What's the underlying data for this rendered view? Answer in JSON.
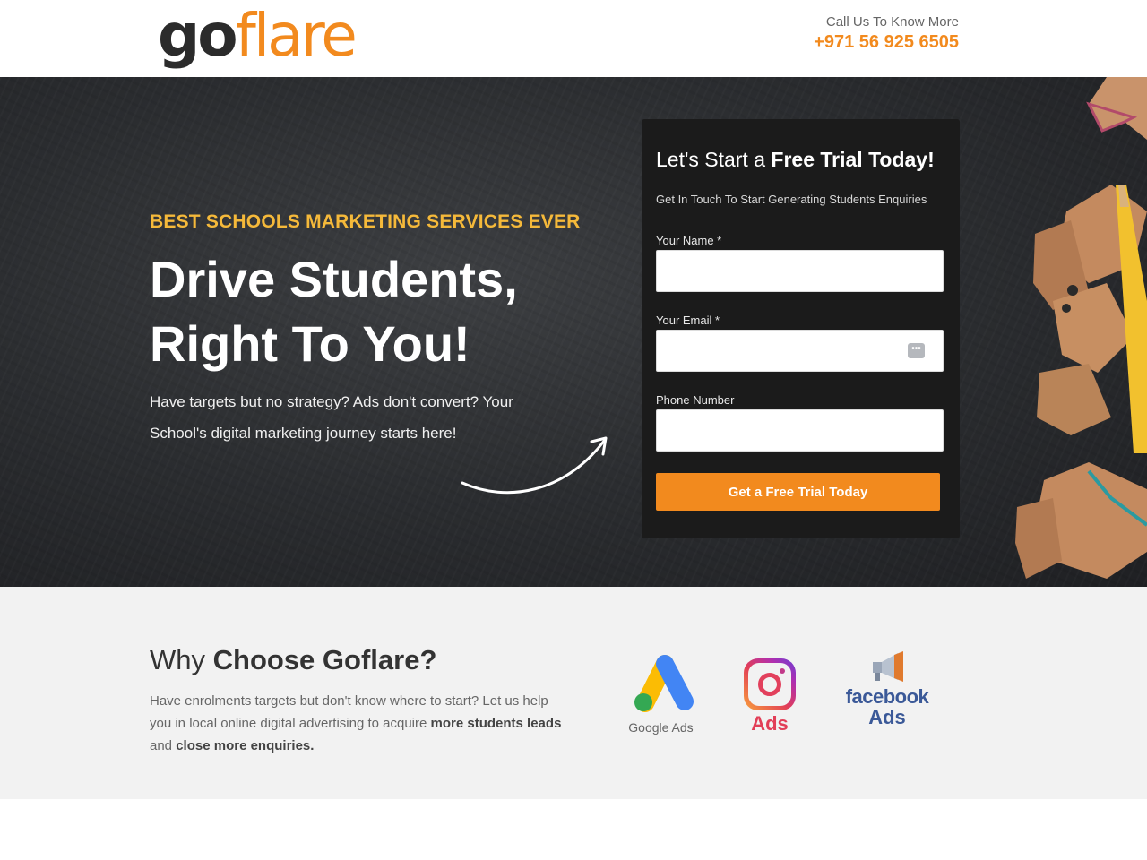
{
  "header": {
    "logo_part1": "go",
    "logo_part2": "flare",
    "call_label": "Call Us To Know More",
    "phone": "+971 56 925 6505"
  },
  "hero": {
    "eyebrow": "BEST SCHOOLS MARKETING SERVICES EVER",
    "headline_line1": "Drive Students,",
    "headline_line2": "Right To You!",
    "description": "Have targets but no strategy? Ads don't convert? Your School's digital marketing journey starts here!"
  },
  "form": {
    "title_regular": "Let's Start a ",
    "title_bold": "Free Trial Today!",
    "subtitle": "Get In Touch To Start Generating Students Enquiries",
    "fields": [
      {
        "label": "Your Name *",
        "value": "",
        "placeholder": ""
      },
      {
        "label": "Your Email *",
        "value": "",
        "placeholder": ""
      },
      {
        "label": "Phone Number",
        "value": "",
        "placeholder": ""
      }
    ],
    "submit_label": "Get a Free Trial Today"
  },
  "why": {
    "title_regular": "Why ",
    "title_bold": "Choose Goflare?",
    "desc_part1": "Have enrolments targets but don't know where to start? Let us help you in local online digital advertising to acquire ",
    "desc_bold1": "more students leads",
    "desc_part2": " and ",
    "desc_bold2": "close more enquiries.",
    "brands": {
      "google_label": "Google Ads",
      "instagram_label": "Ads",
      "facebook_word": "facebook",
      "facebook_ads": "Ads"
    }
  },
  "colors": {
    "accent": "#f28a1e",
    "eyebrow": "#f5b93a",
    "form_bg": "#1b1b1b",
    "section_bg": "#f2f2f2",
    "facebook": "#3b5998"
  },
  "icons": [
    "logo-gear-icon",
    "password-manager-icon",
    "curved-arrow-icon",
    "google-ads-icon",
    "instagram-icon",
    "megaphone-icon"
  ]
}
